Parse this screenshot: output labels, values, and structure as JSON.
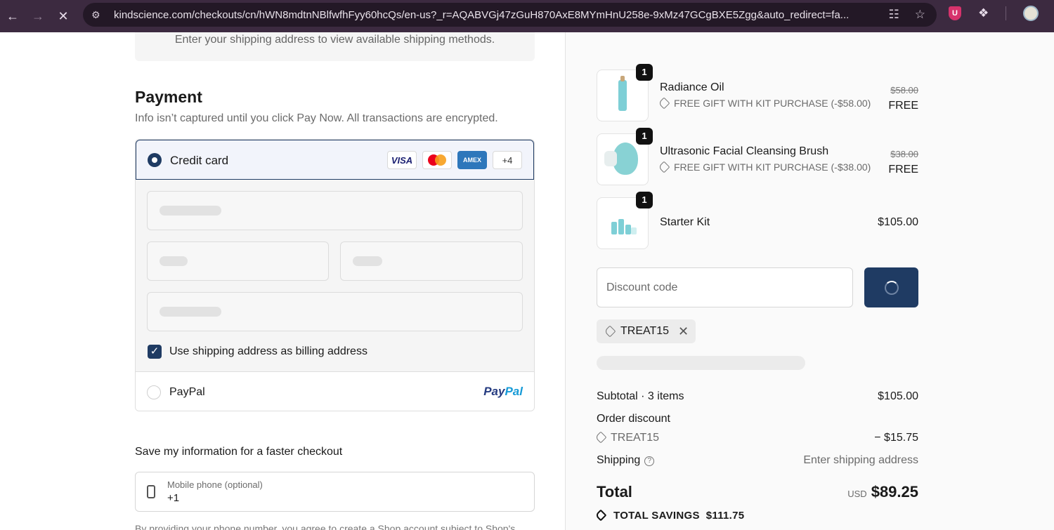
{
  "browser": {
    "url": "kindscience.com/checkouts/cn/hWN8mdtnNBlfwfhFyy60hcQs/en-us?_r=AQABVGj47zGuH870AxE8MYmHnU258e-9xMz47GCgBXE5Zgg&auto_redirect=fa..."
  },
  "shipping_notice": "Enter your shipping address to view available shipping methods.",
  "payment": {
    "title": "Payment",
    "subtitle": "Info isn’t captured until you click Pay Now. All transactions are encrypted.",
    "credit_card_label": "Credit card",
    "card_brands": [
      "VISA",
      "AMEX",
      "+4"
    ],
    "billing_checkbox_label": "Use shipping address as billing address",
    "billing_checked": true,
    "paypal_label": "PayPal",
    "paypal_logo_1": "Pay",
    "paypal_logo_2": "Pal"
  },
  "save_info": {
    "title": "Save my information for a faster checkout",
    "phone_label": "Mobile phone (optional)",
    "phone_value": "+1",
    "fineprint": "By providing your phone number, you agree to create a Shop account subject to Shop's"
  },
  "order": {
    "items": [
      {
        "name": "Radiance Oil",
        "qty": "1",
        "gift": "FREE GIFT WITH KIT PURCHASE (-$58.00)",
        "old_price": "$58.00",
        "price": "FREE"
      },
      {
        "name": "Ultrasonic Facial Cleansing Brush",
        "qty": "1",
        "gift": "FREE GIFT WITH KIT PURCHASE (-$38.00)",
        "old_price": "$38.00",
        "price": "FREE"
      },
      {
        "name": "Starter Kit",
        "qty": "1",
        "price": "$105.00"
      }
    ],
    "discount_placeholder": "Discount code",
    "applied_code": "TREAT15",
    "subtotal_label": "Subtotal · 3 items",
    "subtotal_value": "$105.00",
    "order_discount_label": "Order discount",
    "discount_code_line": "TREAT15",
    "discount_value": "− $15.75",
    "shipping_label": "Shipping",
    "shipping_value": "Enter shipping address",
    "total_label": "Total",
    "total_currency": "USD",
    "total_value": "$89.25",
    "savings_label": "TOTAL SAVINGS",
    "savings_value": "$111.75"
  },
  "colors": {
    "accent": "#1f3b63",
    "chrome": "#3c2a40"
  }
}
